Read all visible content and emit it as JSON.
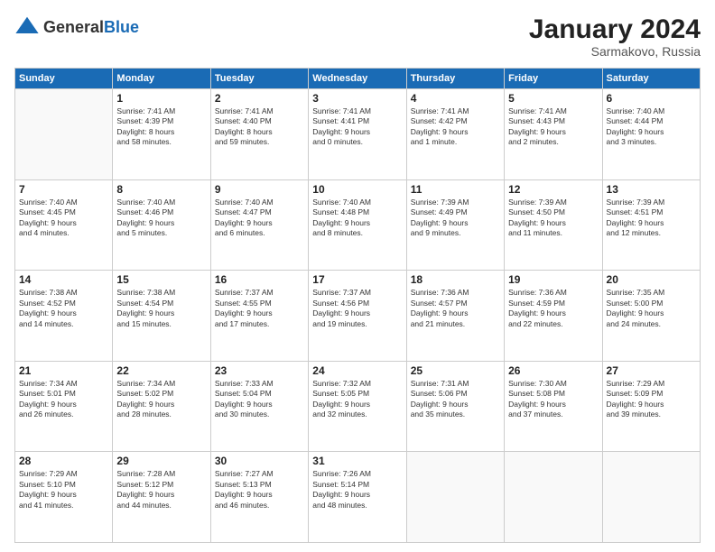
{
  "header": {
    "logo": {
      "general": "General",
      "blue": "Blue"
    },
    "title": "January 2024",
    "location": "Sarmakovo, Russia"
  },
  "days_of_week": [
    "Sunday",
    "Monday",
    "Tuesday",
    "Wednesday",
    "Thursday",
    "Friday",
    "Saturday"
  ],
  "weeks": [
    [
      {
        "day": null,
        "info": null
      },
      {
        "day": "1",
        "info": "Sunrise: 7:41 AM\nSunset: 4:39 PM\nDaylight: 8 hours\nand 58 minutes."
      },
      {
        "day": "2",
        "info": "Sunrise: 7:41 AM\nSunset: 4:40 PM\nDaylight: 8 hours\nand 59 minutes."
      },
      {
        "day": "3",
        "info": "Sunrise: 7:41 AM\nSunset: 4:41 PM\nDaylight: 9 hours\nand 0 minutes."
      },
      {
        "day": "4",
        "info": "Sunrise: 7:41 AM\nSunset: 4:42 PM\nDaylight: 9 hours\nand 1 minute."
      },
      {
        "day": "5",
        "info": "Sunrise: 7:41 AM\nSunset: 4:43 PM\nDaylight: 9 hours\nand 2 minutes."
      },
      {
        "day": "6",
        "info": "Sunrise: 7:40 AM\nSunset: 4:44 PM\nDaylight: 9 hours\nand 3 minutes."
      }
    ],
    [
      {
        "day": "7",
        "info": "Sunrise: 7:40 AM\nSunset: 4:45 PM\nDaylight: 9 hours\nand 4 minutes."
      },
      {
        "day": "8",
        "info": "Sunrise: 7:40 AM\nSunset: 4:46 PM\nDaylight: 9 hours\nand 5 minutes."
      },
      {
        "day": "9",
        "info": "Sunrise: 7:40 AM\nSunset: 4:47 PM\nDaylight: 9 hours\nand 6 minutes."
      },
      {
        "day": "10",
        "info": "Sunrise: 7:40 AM\nSunset: 4:48 PM\nDaylight: 9 hours\nand 8 minutes."
      },
      {
        "day": "11",
        "info": "Sunrise: 7:39 AM\nSunset: 4:49 PM\nDaylight: 9 hours\nand 9 minutes."
      },
      {
        "day": "12",
        "info": "Sunrise: 7:39 AM\nSunset: 4:50 PM\nDaylight: 9 hours\nand 11 minutes."
      },
      {
        "day": "13",
        "info": "Sunrise: 7:39 AM\nSunset: 4:51 PM\nDaylight: 9 hours\nand 12 minutes."
      }
    ],
    [
      {
        "day": "14",
        "info": "Sunrise: 7:38 AM\nSunset: 4:52 PM\nDaylight: 9 hours\nand 14 minutes."
      },
      {
        "day": "15",
        "info": "Sunrise: 7:38 AM\nSunset: 4:54 PM\nDaylight: 9 hours\nand 15 minutes."
      },
      {
        "day": "16",
        "info": "Sunrise: 7:37 AM\nSunset: 4:55 PM\nDaylight: 9 hours\nand 17 minutes."
      },
      {
        "day": "17",
        "info": "Sunrise: 7:37 AM\nSunset: 4:56 PM\nDaylight: 9 hours\nand 19 minutes."
      },
      {
        "day": "18",
        "info": "Sunrise: 7:36 AM\nSunset: 4:57 PM\nDaylight: 9 hours\nand 21 minutes."
      },
      {
        "day": "19",
        "info": "Sunrise: 7:36 AM\nSunset: 4:59 PM\nDaylight: 9 hours\nand 22 minutes."
      },
      {
        "day": "20",
        "info": "Sunrise: 7:35 AM\nSunset: 5:00 PM\nDaylight: 9 hours\nand 24 minutes."
      }
    ],
    [
      {
        "day": "21",
        "info": "Sunrise: 7:34 AM\nSunset: 5:01 PM\nDaylight: 9 hours\nand 26 minutes."
      },
      {
        "day": "22",
        "info": "Sunrise: 7:34 AM\nSunset: 5:02 PM\nDaylight: 9 hours\nand 28 minutes."
      },
      {
        "day": "23",
        "info": "Sunrise: 7:33 AM\nSunset: 5:04 PM\nDaylight: 9 hours\nand 30 minutes."
      },
      {
        "day": "24",
        "info": "Sunrise: 7:32 AM\nSunset: 5:05 PM\nDaylight: 9 hours\nand 32 minutes."
      },
      {
        "day": "25",
        "info": "Sunrise: 7:31 AM\nSunset: 5:06 PM\nDaylight: 9 hours\nand 35 minutes."
      },
      {
        "day": "26",
        "info": "Sunrise: 7:30 AM\nSunset: 5:08 PM\nDaylight: 9 hours\nand 37 minutes."
      },
      {
        "day": "27",
        "info": "Sunrise: 7:29 AM\nSunset: 5:09 PM\nDaylight: 9 hours\nand 39 minutes."
      }
    ],
    [
      {
        "day": "28",
        "info": "Sunrise: 7:29 AM\nSunset: 5:10 PM\nDaylight: 9 hours\nand 41 minutes."
      },
      {
        "day": "29",
        "info": "Sunrise: 7:28 AM\nSunset: 5:12 PM\nDaylight: 9 hours\nand 44 minutes."
      },
      {
        "day": "30",
        "info": "Sunrise: 7:27 AM\nSunset: 5:13 PM\nDaylight: 9 hours\nand 46 minutes."
      },
      {
        "day": "31",
        "info": "Sunrise: 7:26 AM\nSunset: 5:14 PM\nDaylight: 9 hours\nand 48 minutes."
      },
      {
        "day": null,
        "info": null
      },
      {
        "day": null,
        "info": null
      },
      {
        "day": null,
        "info": null
      }
    ]
  ]
}
